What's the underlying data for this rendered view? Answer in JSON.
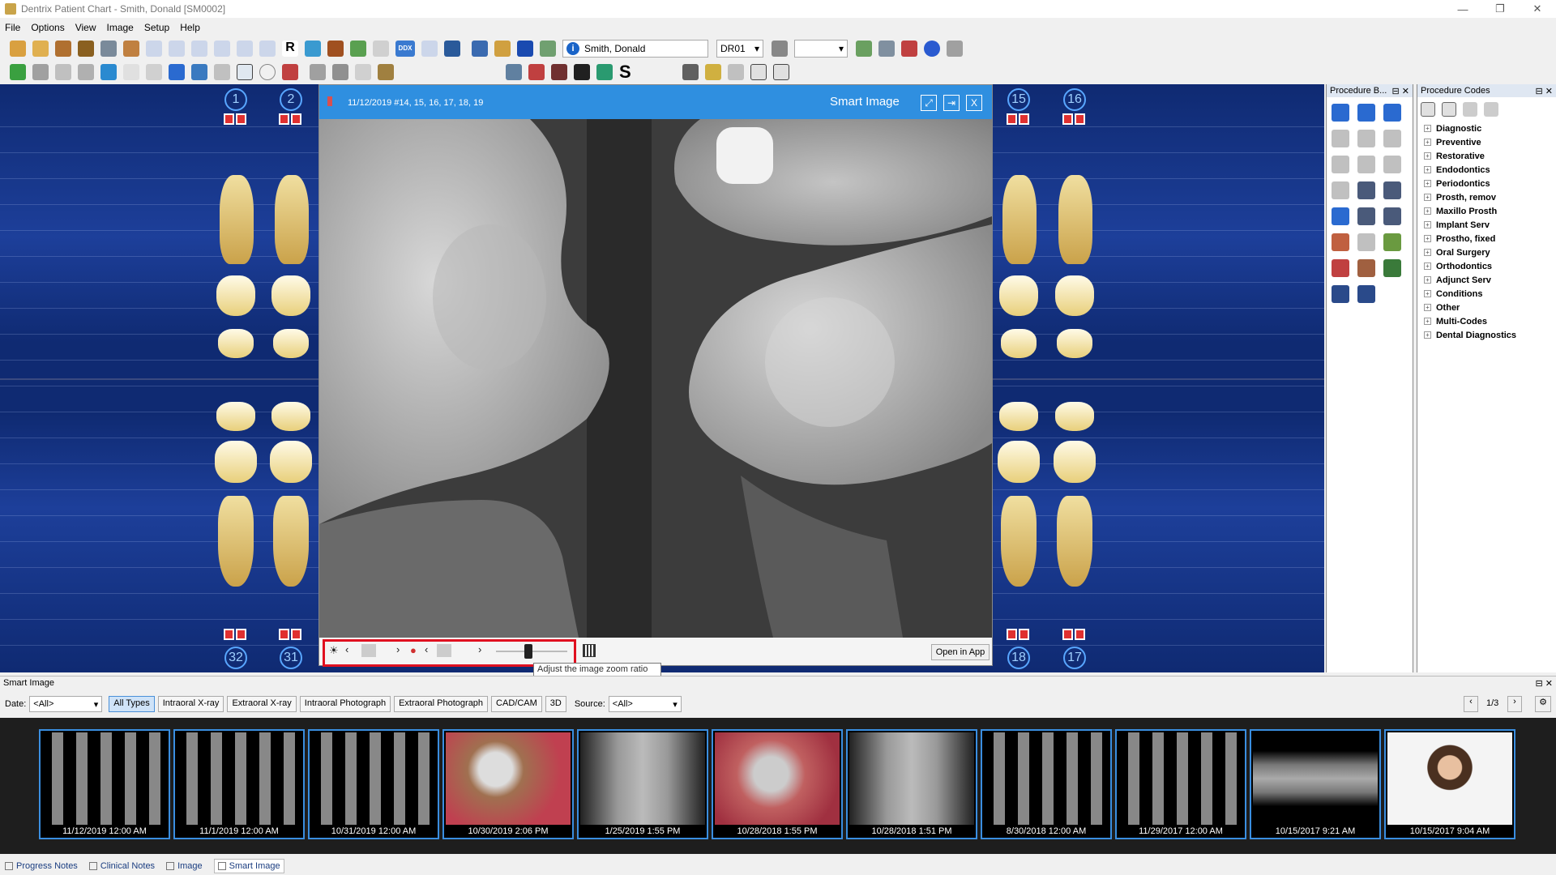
{
  "window": {
    "title": "Dentrix Patient Chart - Smith, Donald [SM0002]"
  },
  "menu": [
    "File",
    "Options",
    "View",
    "Image",
    "Setup",
    "Help"
  ],
  "toolbar": {
    "patient": "Smith, Donald",
    "provider": "DR01"
  },
  "teeth": {
    "top_left": [
      "1",
      "2"
    ],
    "top_right": [
      "15",
      "16"
    ],
    "bottom_left": [
      "32",
      "31"
    ],
    "bottom_right": [
      "18",
      "17"
    ]
  },
  "smart_image_viewer": {
    "meta": "11/12/2019 #14, 15, 16, 17, 18, 19",
    "title": "Smart Image",
    "open_in_app": "Open in App",
    "zoom_tooltip": "Adjust the image zoom ratio",
    "zoom_level": 0.45
  },
  "procedure_buttons": {
    "title": "Procedure B..."
  },
  "procedure_codes": {
    "title": "Procedure Codes",
    "items": [
      "Diagnostic",
      "Preventive",
      "Restorative",
      "Endodontics",
      "Periodontics",
      "Prosth, remov",
      "Maxillo Prosth",
      "Implant Serv",
      "Prostho, fixed",
      "Oral Surgery",
      "Orthodontics",
      "Adjunct Serv",
      "Conditions",
      "Other",
      "Multi-Codes",
      "Dental Diagnostics"
    ]
  },
  "smart_image_panel": {
    "title": "Smart Image",
    "date_label": "Date:",
    "date_value": "<All>",
    "types": [
      "All Types",
      "Intraoral X-ray",
      "Extraoral X-ray",
      "Intraoral Photograph",
      "Extraoral Photograph",
      "CAD/CAM",
      "3D"
    ],
    "source_label": "Source:",
    "source_value": "<All>",
    "page": "1/3",
    "thumbnails": [
      "11/12/2019 12:00 AM",
      "11/1/2019 12:00 AM",
      "10/31/2019 12:00 AM",
      "10/30/2019 2:06 PM",
      "1/25/2019 1:55 PM",
      "10/28/2018 1:55 PM",
      "10/28/2018 1:51 PM",
      "8/30/2018 12:00 AM",
      "11/29/2017 12:00 AM",
      "10/15/2017 9:21 AM",
      "10/15/2017 9:04 AM"
    ]
  },
  "bottom_tabs": [
    "Progress Notes",
    "Clinical Notes",
    "Image",
    "Smart Image"
  ]
}
